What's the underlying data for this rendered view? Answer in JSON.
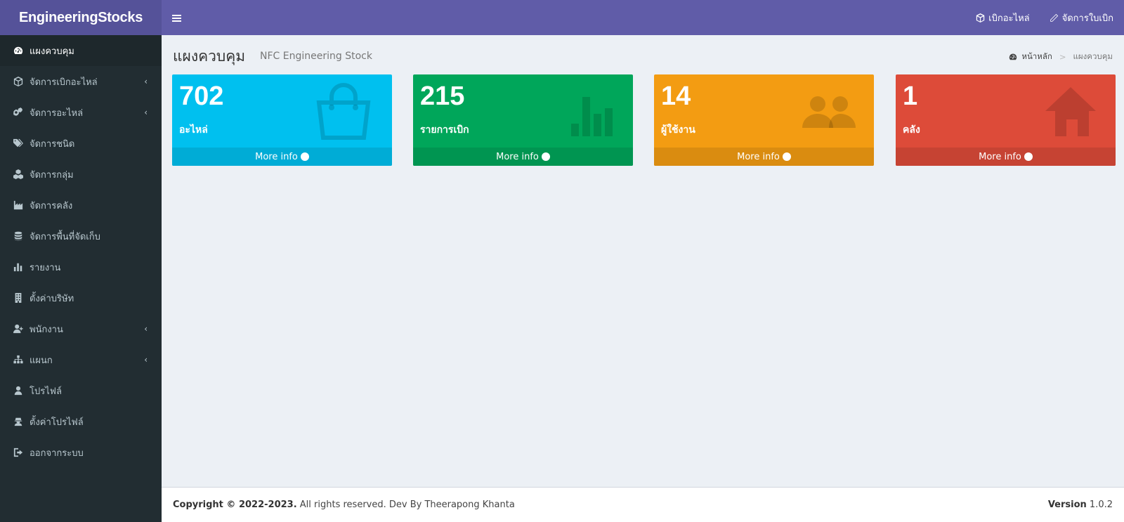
{
  "header": {
    "logo": "EngineeringStocks",
    "nav": [
      {
        "label": "เบิกอะไหล่",
        "icon": "cube-icon"
      },
      {
        "label": "จัดการใบเบิก",
        "icon": "pencil-icon"
      }
    ]
  },
  "sidebar": {
    "items": [
      {
        "label": "แผงควบคุม",
        "icon": "dashboard-icon",
        "active": true
      },
      {
        "label": "จัดการเบิกอะไหล่",
        "icon": "cube-icon",
        "chevron": "‹"
      },
      {
        "label": "จัดการอะไหล่",
        "icon": "cogs-icon",
        "chevron": "‹"
      },
      {
        "label": "จัดการชนิด",
        "icon": "tags-icon"
      },
      {
        "label": "จัดการกลุ่ม",
        "icon": "cubes-icon"
      },
      {
        "label": "จัดการคลัง",
        "icon": "industry-icon"
      },
      {
        "label": "จัดการพื้นที่จัดเก็บ",
        "icon": "database-icon"
      },
      {
        "label": "รายงาน",
        "icon": "bar-chart-icon"
      },
      {
        "label": "ตั้งค่าบริษัท",
        "icon": "building-icon"
      },
      {
        "label": "พนักงาน",
        "icon": "user-plus-icon",
        "chevron": "‹"
      },
      {
        "label": "แผนก",
        "icon": "sitemap-icon",
        "chevron": "‹"
      },
      {
        "label": "โปรไฟล์",
        "icon": "user-icon"
      },
      {
        "label": "ตั้งค่าโปรไฟล์",
        "icon": "user-secret-icon"
      },
      {
        "label": "ออกจากระบบ",
        "icon": "sign-out-icon"
      }
    ]
  },
  "content": {
    "title": "แผงควบคุม",
    "subtitle": "NFC Engineering Stock",
    "breadcrumb": {
      "home": "หน้าหลัก",
      "sep": ">",
      "current": "แผงควบคุม"
    }
  },
  "boxes": [
    {
      "value": "702",
      "label": "อะไหล่",
      "more": "More info",
      "icon": "shopping-bag-icon",
      "color": "#00c0ef"
    },
    {
      "value": "215",
      "label": "รายการเบิก",
      "more": "More info",
      "icon": "bar-chart-icon",
      "color": "#00a65a"
    },
    {
      "value": "14",
      "label": "ผู้ใช้งาน",
      "more": "More info",
      "icon": "users-icon",
      "color": "#f39c12"
    },
    {
      "value": "1",
      "label": "คลัง",
      "more": "More info",
      "icon": "home-icon",
      "color": "#dd4b39"
    }
  ],
  "footer": {
    "copyright": "Copyright © 2022-2023.",
    "rights": " All rights reserved. Dev By Theerapong Khanta",
    "version_label": "Version",
    "version": " 1.0.2"
  }
}
